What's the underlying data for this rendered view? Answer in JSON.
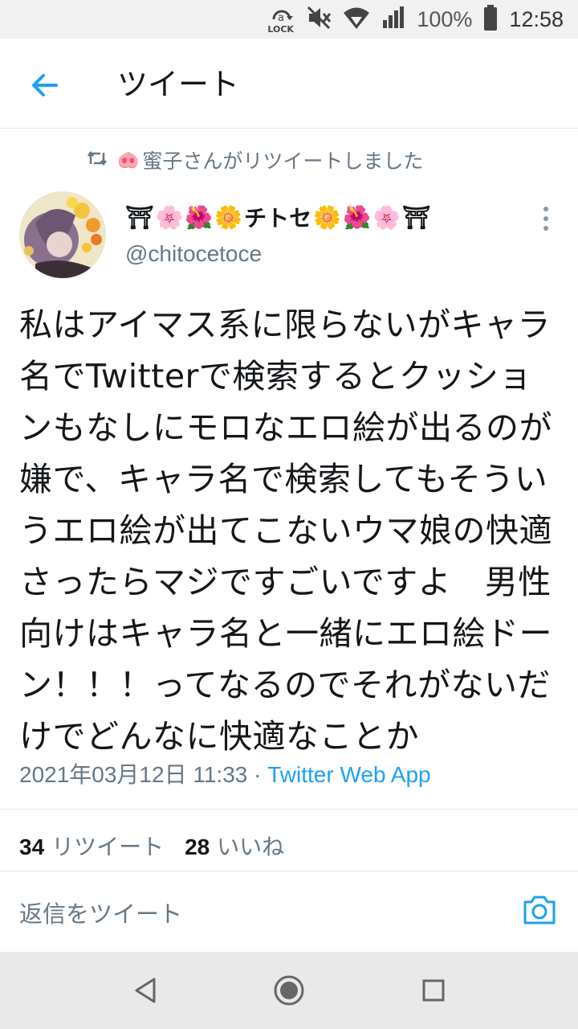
{
  "status_bar": {
    "lock_label": "LOCK",
    "battery_percent": "100%",
    "time": "12:58",
    "icons": [
      "lock-rotate-icon",
      "mute-icon",
      "wifi-icon",
      "signal-icon",
      "battery-icon"
    ]
  },
  "header": {
    "title": "ツイート",
    "back_icon": "arrow-left-icon"
  },
  "retweet_context": {
    "icon": "retweet-icon",
    "user_emoji": "🐽",
    "text": "蜜子さんがリツイートしました"
  },
  "tweet": {
    "author": {
      "name_symbols": [
        "⛩",
        "🌸",
        "🌺",
        "🌼"
      ],
      "name_core": "チトセ",
      "name_symbols_after": [
        "🌼",
        "🌺",
        "🌸",
        "⛩"
      ],
      "handle": "@chitocetoce"
    },
    "text": "私はアイマス系に限らないがキャラ名でTwitterで検索するとクッションもなしにモロなエロ絵が出るのが嫌で、キャラ名で検索してもそういうエロ絵が出てこないウマ娘の快適さったらマジですごいですよ　男性向けはキャラ名と一緒にエロ絵ドーン！！！ってなるのでそれがないだけでどんなに快適なことか",
    "timestamp": "2021年03月12日 11:33",
    "separator": " · ",
    "source": "Twitter Web App",
    "stats": {
      "retweets_count": "34",
      "retweets_label": "リツイート",
      "likes_count": "28",
      "likes_label": "いいね"
    }
  },
  "reply": {
    "placeholder": "返信をツイート",
    "camera_icon": "camera-icon"
  },
  "colors": {
    "accent": "#1da1f2",
    "secondary_text": "#657786",
    "divider": "#e1e8ed"
  },
  "nav_bar": {
    "icons": [
      "back-triangle-icon",
      "home-circle-icon",
      "recents-square-icon"
    ]
  }
}
